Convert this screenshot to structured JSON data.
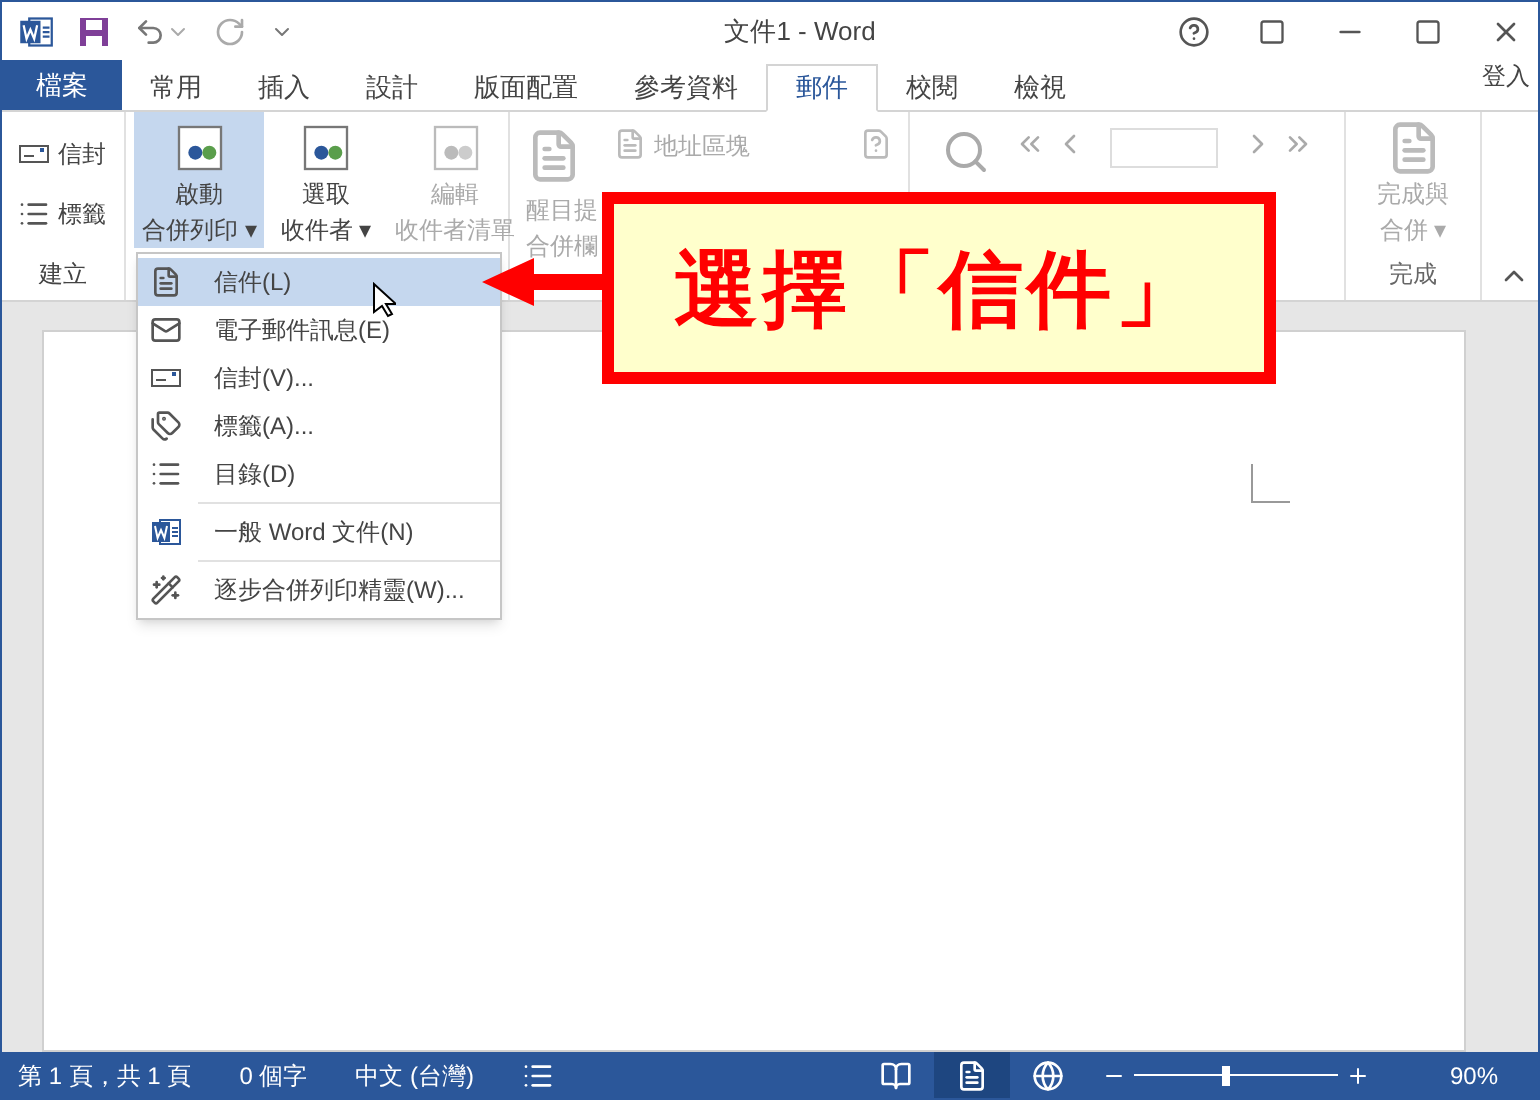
{
  "window": {
    "title": "文件1 - Word"
  },
  "tabs": [
    {
      "label": "檔案",
      "kind": "file",
      "selected": false
    },
    {
      "label": "常用",
      "kind": "tab",
      "selected": false
    },
    {
      "label": "插入",
      "kind": "tab",
      "selected": false
    },
    {
      "label": "設計",
      "kind": "tab",
      "selected": false
    },
    {
      "label": "版面配置",
      "kind": "tab",
      "selected": false
    },
    {
      "label": "參考資料",
      "kind": "tab",
      "selected": false
    },
    {
      "label": "郵件",
      "kind": "tab",
      "selected": true
    },
    {
      "label": "校閱",
      "kind": "tab",
      "selected": false
    },
    {
      "label": "檢視",
      "kind": "tab",
      "selected": false
    }
  ],
  "sign_in": "登入",
  "ribbon": {
    "create": {
      "label": "建立",
      "items": [
        "信封",
        "標籤"
      ]
    },
    "start": [
      {
        "lines": [
          "啟動",
          "合併列印"
        ],
        "selected": true,
        "disabled": false,
        "caret": "▾"
      },
      {
        "lines": [
          "選取",
          "收件者"
        ],
        "selected": false,
        "disabled": false,
        "caret": "▾"
      },
      {
        "lines": [
          "編輯",
          "收件者清單"
        ],
        "selected": false,
        "disabled": true
      }
    ],
    "fields": {
      "highlight": [
        "醒目提",
        "合併欄"
      ],
      "address_block": "地址區塊"
    },
    "finish": {
      "lines": [
        "完成與",
        "合併"
      ],
      "caret": "▾",
      "label": "完成"
    }
  },
  "menu": [
    {
      "kind": "item",
      "label": "信件(L)",
      "selected": true
    },
    {
      "kind": "item",
      "label": "電子郵件訊息(E)",
      "selected": false
    },
    {
      "kind": "item",
      "label": "信封(V)...",
      "selected": false
    },
    {
      "kind": "item",
      "label": "標籤(A)...",
      "selected": false
    },
    {
      "kind": "item",
      "label": "目錄(D)",
      "selected": false
    },
    {
      "kind": "separator"
    },
    {
      "kind": "item",
      "label": "一般 Word 文件(N)",
      "selected": false
    },
    {
      "kind": "separator"
    },
    {
      "kind": "item",
      "label": "逐步合併列印精靈(W)...",
      "selected": false
    }
  ],
  "callout": "選擇「信件」",
  "status_bar": {
    "page": "第 1 頁，共 1 頁",
    "words": "0 個字",
    "language": "中文 (台灣)",
    "views": [
      {
        "kind": "read",
        "selected": false
      },
      {
        "kind": "print",
        "selected": true
      },
      {
        "kind": "web",
        "selected": false
      }
    ],
    "zoom": {
      "level": 0.45,
      "reading": "90%"
    }
  }
}
